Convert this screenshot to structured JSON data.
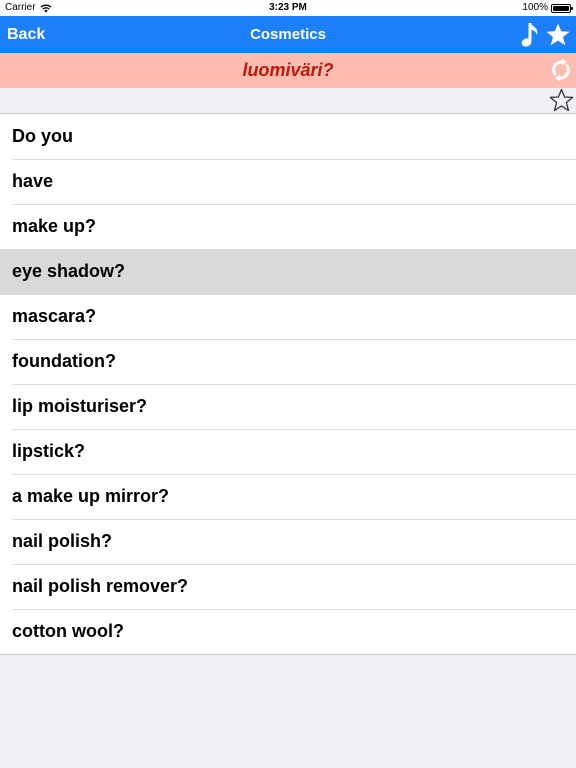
{
  "status_bar": {
    "carrier": "Carrier",
    "time": "3:23 PM",
    "battery": "100%"
  },
  "nav": {
    "back_label": "Back",
    "title": "Cosmetics",
    "icons": [
      "music-note-icon",
      "star-filled-icon"
    ]
  },
  "translation": {
    "phrase": "luomiväri?",
    "icon": "swap-arrows-icon"
  },
  "favorite": {
    "icon": "star-outline-icon"
  },
  "colors": {
    "nav_background": "#1e7ffa",
    "translation_background": "#ffbcb0",
    "translation_text": "#c0170b",
    "selected_row": "#d9d9d9",
    "page_background": "#efeff4"
  },
  "phrases": [
    {
      "label": "Do you",
      "selected": false
    },
    {
      "label": "have",
      "selected": false
    },
    {
      "label": "make up?",
      "selected": false
    },
    {
      "label": "eye shadow?",
      "selected": true
    },
    {
      "label": "mascara?",
      "selected": false
    },
    {
      "label": "foundation?",
      "selected": false
    },
    {
      "label": "lip moisturiser?",
      "selected": false
    },
    {
      "label": "lipstick?",
      "selected": false
    },
    {
      "label": "a make up mirror?",
      "selected": false
    },
    {
      "label": "nail polish?",
      "selected": false
    },
    {
      "label": "nail polish remover?",
      "selected": false
    },
    {
      "label": "cotton wool?",
      "selected": false
    }
  ]
}
